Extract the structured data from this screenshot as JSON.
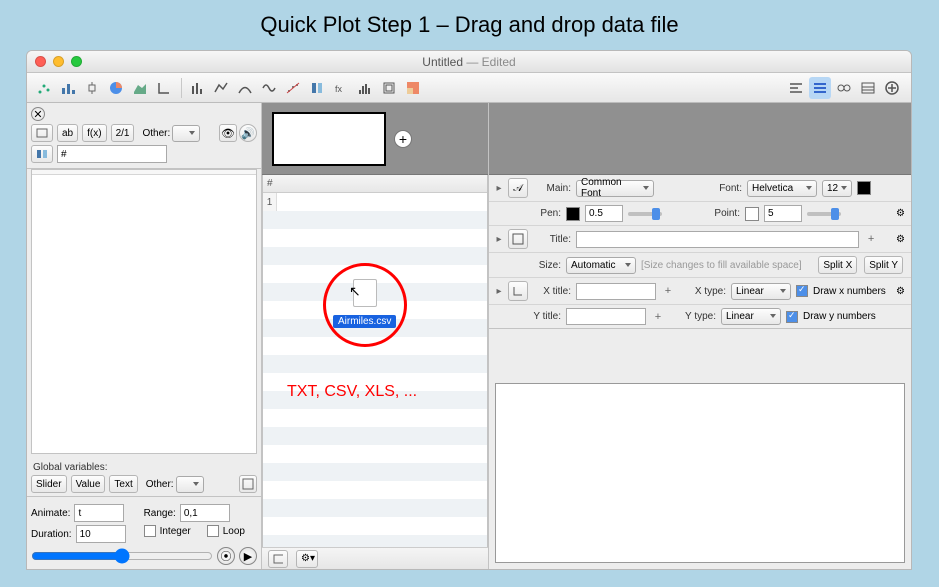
{
  "page_title": "Quick Plot Step 1 – Drag and drop data file",
  "window": {
    "title_name": "Untitled",
    "title_status": "Edited"
  },
  "left_panel": {
    "tab_labels": [
      "",
      "ab",
      "f(x)",
      "2/1"
    ],
    "other_label": "Other:",
    "hash_label": "#",
    "globals_label": "Global variables:",
    "gv_tabs": [
      "Slider",
      "Value",
      "Text"
    ],
    "gv_other": "Other:",
    "animate_label": "Animate:",
    "animate_value": "t",
    "range_label": "Range:",
    "range_value": "0,1",
    "duration_label": "Duration:",
    "duration_value": "10",
    "integer_label": "Integer",
    "loop_label": "Loop"
  },
  "center": {
    "col_header": "#",
    "row1": "1",
    "drag_filename": "Airmiles.csv",
    "formats_note": "TXT, CSV, XLS, ..."
  },
  "inspector": {
    "main_label": "Main:",
    "main_value": "Common Font",
    "font_label": "Font:",
    "font_value": "Helvetica",
    "font_size": "12",
    "pen_label": "Pen:",
    "pen_value": "0.5",
    "point_label": "Point:",
    "point_value": "5",
    "title_label": "Title:",
    "size_label": "Size:",
    "size_value": "Automatic",
    "size_hint": "[Size changes to fill available space]",
    "split_x": "Split X",
    "split_y": "Split Y",
    "xtitle_label": "X title:",
    "ytitle_label": "Y title:",
    "xtype_label": "X type:",
    "xtype_value": "Linear",
    "ytype_label": "Y type:",
    "ytype_value": "Linear",
    "draw_xnum": "Draw x numbers",
    "draw_ynum": "Draw y numbers"
  }
}
